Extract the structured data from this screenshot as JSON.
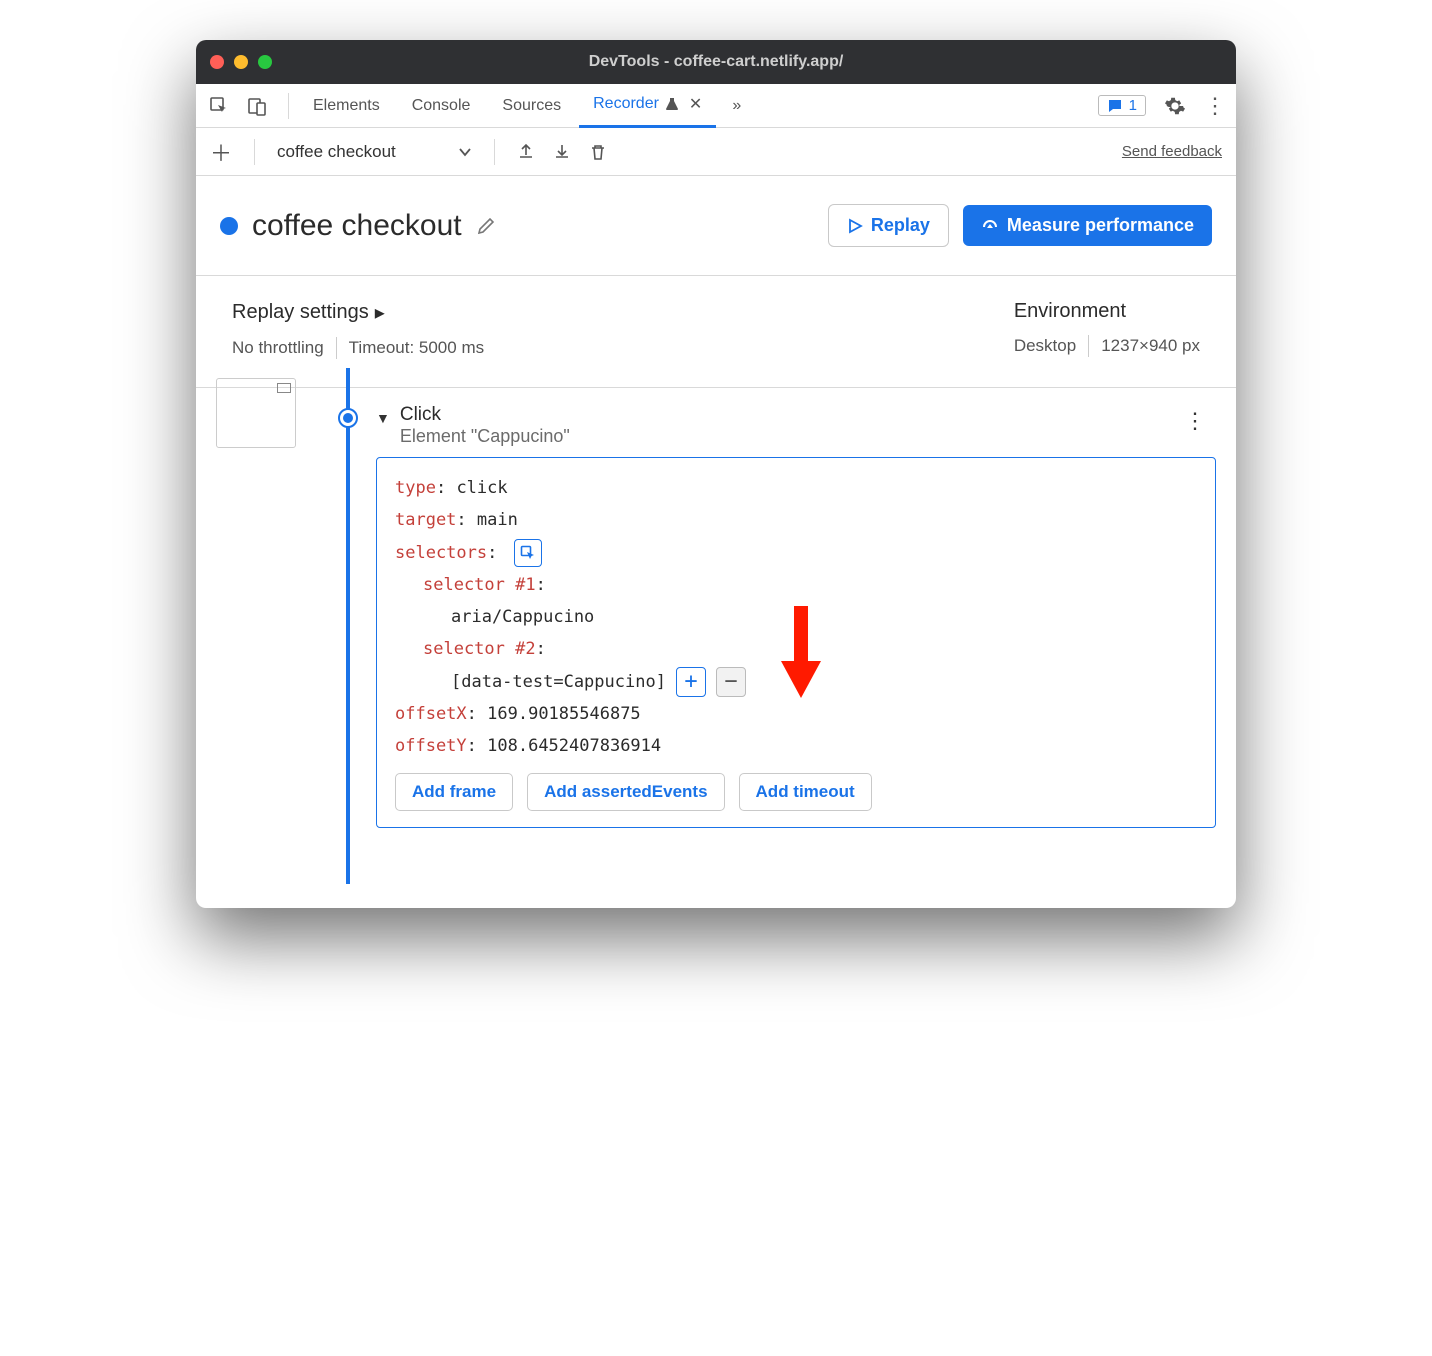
{
  "window": {
    "title": "DevTools - coffee-cart.netlify.app/"
  },
  "tabs": {
    "elements": "Elements",
    "console": "Console",
    "sources": "Sources",
    "recorder": "Recorder",
    "issues_count": "1"
  },
  "toolbar": {
    "recording_name": "coffee checkout",
    "send_feedback": "Send feedback"
  },
  "header": {
    "title": "coffee checkout",
    "replay": "Replay",
    "measure": "Measure performance"
  },
  "settings": {
    "replay_title": "Replay settings",
    "throttling": "No throttling",
    "timeout": "Timeout: 5000 ms",
    "env_title": "Environment",
    "device": "Desktop",
    "dimensions": "1237×940 px"
  },
  "step": {
    "title": "Click",
    "subtitle": "Element \"Cappucino\"",
    "type_label": "type",
    "type_value": "click",
    "target_label": "target",
    "target_value": "main",
    "selectors_label": "selectors",
    "sel1_label": "selector #1",
    "sel1_value": "aria/Cappucino",
    "sel2_label": "selector #2",
    "sel2_value": "[data-test=Cappucino]",
    "offsetX_label": "offsetX",
    "offsetX_value": "169.90185546875",
    "offsetY_label": "offsetY",
    "offsetY_value": "108.6452407836914",
    "add_frame": "Add frame",
    "add_asserted": "Add assertedEvents",
    "add_timeout": "Add timeout"
  }
}
